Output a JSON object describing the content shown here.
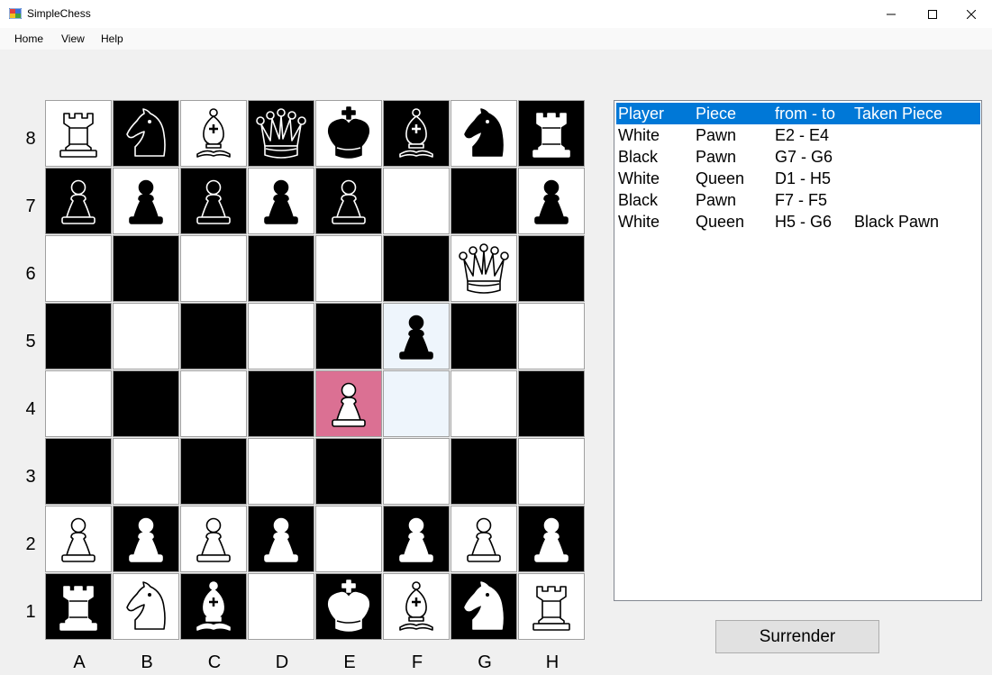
{
  "window": {
    "title": "SimpleChess"
  },
  "menu": {
    "items": [
      "Home",
      "View",
      "Help"
    ]
  },
  "board": {
    "colors": {
      "light": "#ffffff",
      "dark": "#000000",
      "selected": "#db7093",
      "highlight": "#eef5fc",
      "border": "#a0a0a0"
    },
    "rank_labels": [
      "8",
      "7",
      "6",
      "5",
      "4",
      "3",
      "2",
      "1"
    ],
    "file_labels": [
      "A",
      "B",
      "C",
      "D",
      "E",
      "F",
      "G",
      "H"
    ],
    "squares": [
      [
        "R",
        "n",
        "B",
        "q",
        "k",
        "b",
        "n",
        "R"
      ],
      [
        "p",
        "p",
        "p",
        "p",
        "p",
        "",
        "",
        "p"
      ],
      [
        "",
        "",
        "",
        "",
        "",
        "",
        "Q",
        ""
      ],
      [
        "",
        "",
        "",
        "",
        "",
        "p",
        "",
        ""
      ],
      [
        "",
        "",
        "",
        "",
        "P",
        "",
        "",
        ""
      ],
      [
        "",
        "",
        "",
        "",
        "",
        "",
        "",
        ""
      ],
      [
        "P",
        "P",
        "P",
        "P",
        "",
        "P",
        "P",
        "P"
      ],
      [
        "R",
        "N",
        "B",
        "",
        "K",
        "B",
        "N",
        "R"
      ]
    ],
    "selected_square": "E4",
    "highlighted_squares": [
      "F4",
      "F5"
    ]
  },
  "move_list": {
    "header": {
      "player": "Player",
      "piece": "Piece",
      "fromto": "from - to",
      "taken": "Taken Piece"
    },
    "rows": [
      {
        "player": "White",
        "piece": "Pawn",
        "fromto": "E2 - E4",
        "taken": ""
      },
      {
        "player": "Black",
        "piece": "Pawn",
        "fromto": "G7 - G6",
        "taken": ""
      },
      {
        "player": "White",
        "piece": "Queen",
        "fromto": "D1 - H5",
        "taken": ""
      },
      {
        "player": "Black",
        "piece": "Pawn",
        "fromto": "F7 - F5",
        "taken": ""
      },
      {
        "player": "White",
        "piece": "Queen",
        "fromto": "H5 - G6",
        "taken": "Black Pawn"
      }
    ],
    "header_color": "#0078d7"
  },
  "surrender_label": "Surrender"
}
